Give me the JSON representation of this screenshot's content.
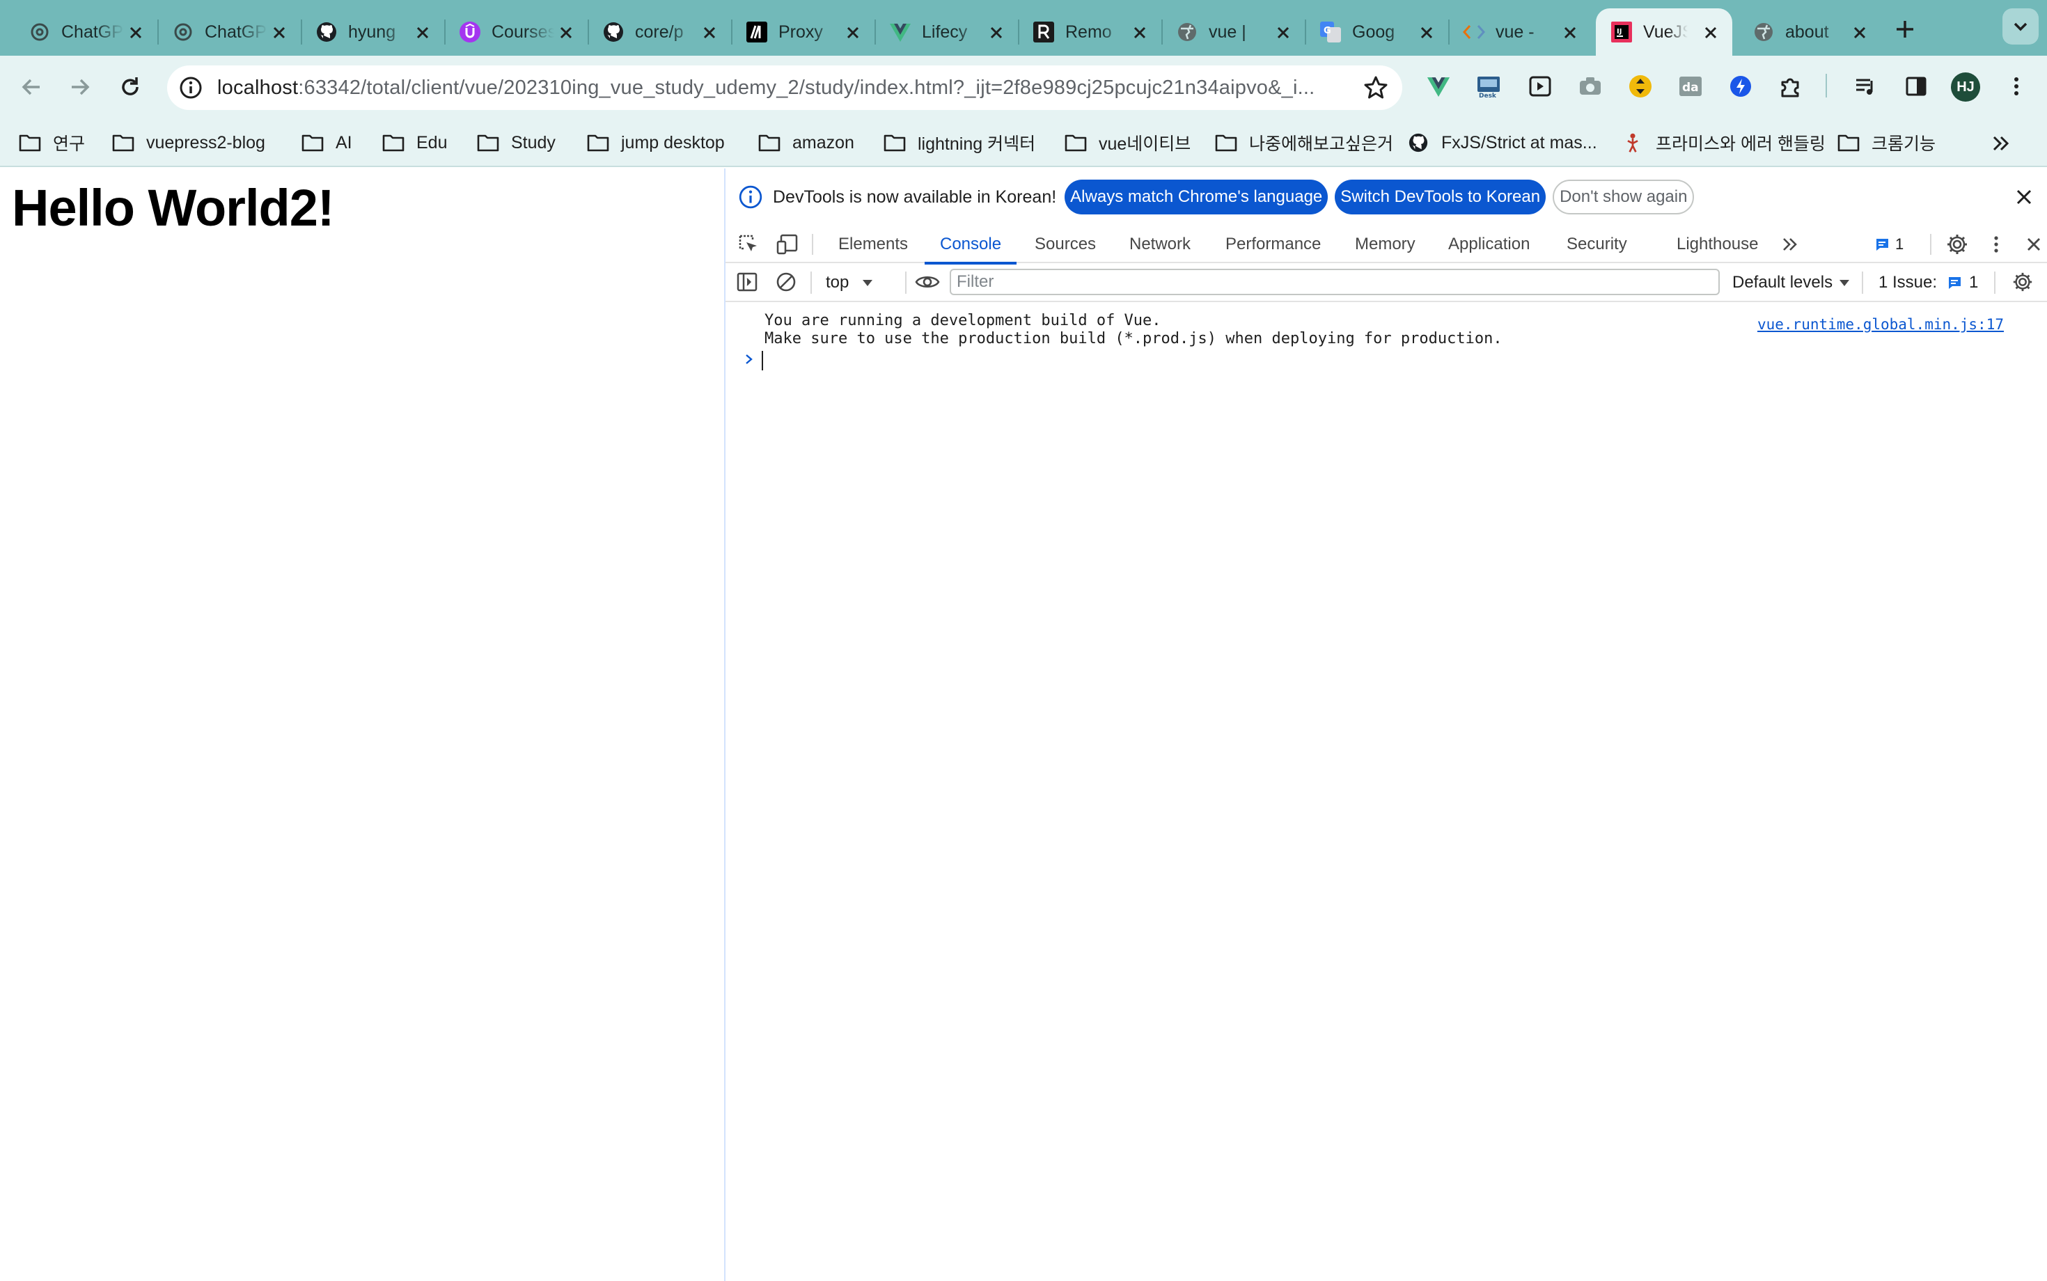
{
  "browser": {
    "tabs": [
      {
        "title": "ChatGPT",
        "icon": "openai-icon"
      },
      {
        "title": "ChatGPT",
        "icon": "openai-icon"
      },
      {
        "title": "hyung",
        "icon": "github-icon"
      },
      {
        "title": "Courses",
        "icon": "udemy-icon"
      },
      {
        "title": "core/p",
        "icon": "github-icon"
      },
      {
        "title": "Proxy",
        "icon": "mdn-icon"
      },
      {
        "title": "Lifecy",
        "icon": "vue-icon"
      },
      {
        "title": "Remo",
        "icon": "r-icon"
      },
      {
        "title": "vue | ",
        "icon": "globe-icon"
      },
      {
        "title": "Goog",
        "icon": "google-translate-icon"
      },
      {
        "title": "vue -",
        "icon": "code-icon"
      },
      {
        "title": "VueJS",
        "icon": "jetbrains-icon",
        "active": true
      },
      {
        "title": "about",
        "icon": "globe-icon"
      }
    ],
    "url": {
      "host": "localhost",
      "path": ":63342/total/client/vue/202310ing_vue_study_udemy_2/study/index.html?_ijt=2f8e989cj25pcujc21n34aipvo&_i..."
    },
    "profile_initials": "HJ",
    "bookmarks": [
      {
        "label": "연구",
        "icon": "folder-icon"
      },
      {
        "label": "vuepress2-blog",
        "icon": "folder-icon"
      },
      {
        "label": "AI",
        "icon": "folder-icon"
      },
      {
        "label": "Edu",
        "icon": "folder-icon"
      },
      {
        "label": "Study",
        "icon": "folder-icon"
      },
      {
        "label": "jump desktop",
        "icon": "folder-icon"
      },
      {
        "label": "amazon",
        "icon": "folder-icon"
      },
      {
        "label": "lightning 커넥터",
        "icon": "folder-icon"
      },
      {
        "label": "vue네이티브",
        "icon": "folder-icon"
      },
      {
        "label": "나중에해보고싶은거",
        "icon": "folder-icon"
      },
      {
        "label": "FxJS/Strict at mas...",
        "icon": "github-icon"
      },
      {
        "label": "프라미스와 에러 핸들링",
        "icon": "javascript-info-icon"
      },
      {
        "label": "크롬기능",
        "icon": "folder-icon"
      }
    ]
  },
  "page": {
    "heading": "Hello World2!"
  },
  "devtools": {
    "infobar": {
      "text": "DevTools is now available in Korean!",
      "match_button": "Always match Chrome's language",
      "switch_button": "Switch DevTools to Korean",
      "dismiss_button": "Don't show again"
    },
    "tabs": [
      "Elements",
      "Console",
      "Sources",
      "Network",
      "Performance",
      "Memory",
      "Application",
      "Security",
      "Lighthouse"
    ],
    "active_tab": "Console",
    "issue_badge_count": "1",
    "console": {
      "context": "top",
      "filter_placeholder": "Filter",
      "levels": "Default levels",
      "issues_label": "1 Issue:",
      "issues_count": "1",
      "messages": [
        "You are running a development build of Vue.",
        "Make sure to use the production build (*.prod.js) when deploying for production."
      ],
      "source": "vue.runtime.global.min.js:17"
    }
  },
  "colors": {
    "tabstrip": "#72b9b9",
    "toolbar": "#e6f3f3",
    "accent": "#0b57d0"
  }
}
